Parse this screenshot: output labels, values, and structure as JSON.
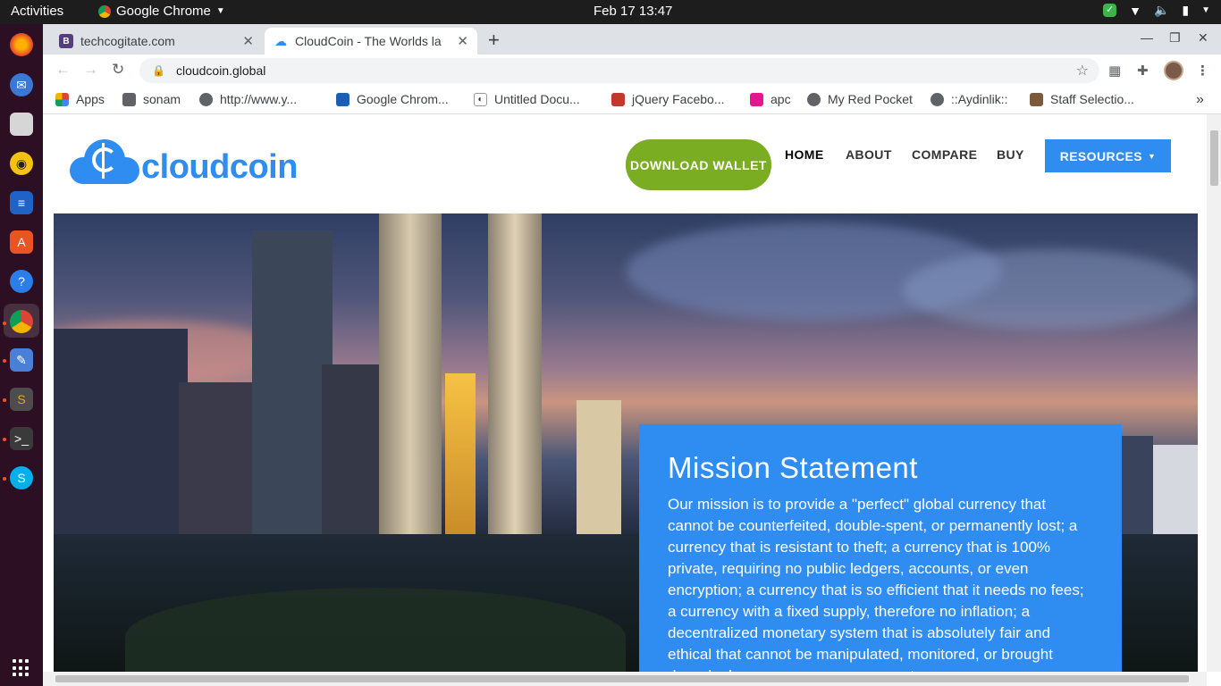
{
  "topbar": {
    "activities": "Activities",
    "app_name": "Google Chrome",
    "clock": "Feb 17  13:47"
  },
  "tabs": [
    {
      "title": "techcogitate.com",
      "favicon": "B",
      "favicon_color": "#563d7c",
      "active": false
    },
    {
      "title": "CloudCoin - The Worlds la",
      "favicon": "cloud-icon",
      "favicon_color": "#2f8cf0",
      "active": true
    }
  ],
  "omnibox": {
    "url": "cloudcoin.global"
  },
  "bookmarks": [
    {
      "label": "Apps",
      "icon": "apps-grid-icon"
    },
    {
      "label": "sonam",
      "icon": "folder-icon"
    },
    {
      "label": "http://www.y...",
      "icon": "globe-icon"
    },
    {
      "label": "Google Chrom...",
      "icon": "sheet-icon"
    },
    {
      "label": "Untitled Docu...",
      "icon": "doc-icon"
    },
    {
      "label": "jQuery Facebo...",
      "icon": "jquery-icon"
    },
    {
      "label": "apc",
      "icon": "apc-icon"
    },
    {
      "label": "My Red Pocket",
      "icon": "globe-icon"
    },
    {
      "label": "::Aydinlik::",
      "icon": "globe-icon"
    },
    {
      "label": "Staff Selectio...",
      "icon": "ssc-icon"
    }
  ],
  "site": {
    "logo_text": "cloudcoin",
    "download_label": "DOWNLOAD WALLET",
    "nav": [
      "HOME",
      "ABOUT",
      "COMPARE",
      "BUY"
    ],
    "resources_label": "RESOURCES",
    "mission_title": "Mission Statement",
    "mission_text": "Our mission is to provide a \"perfect\" global currency that cannot be counterfeited, double-spent, or permanently lost; a currency that is resistant to theft; a currency that is 100% private, requiring no public ledgers, accounts, or even encryption; a currency that is so efficient that it needs no fees; a currency with a fixed supply, therefore no inflation; a decentralized monetary system that is absolutely fair and ethical that cannot be manipulated, monitored, or brought down by bureaucracy or government."
  },
  "colors": {
    "brand_blue": "#2f8cf0",
    "download_green": "#7bad22",
    "dock_bg": "#2c0f22"
  }
}
